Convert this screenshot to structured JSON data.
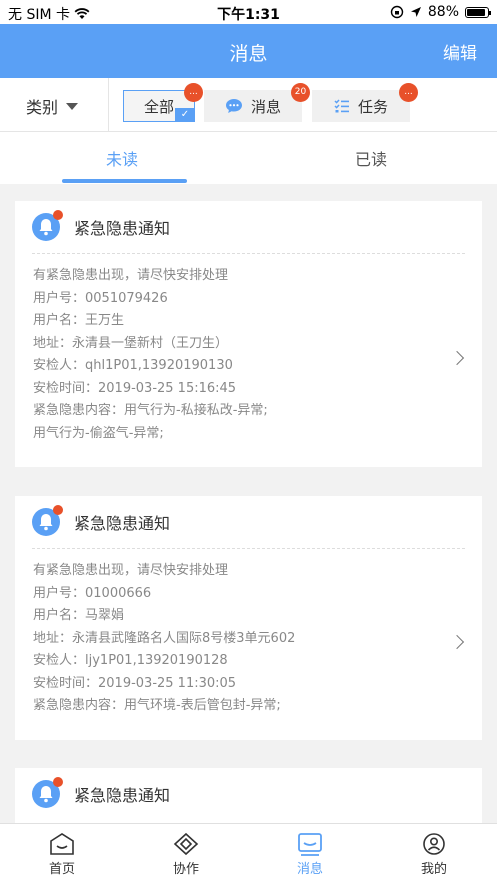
{
  "status_bar": {
    "carrier": "无 SIM 卡",
    "time": "下午1:31",
    "battery": "88%"
  },
  "nav": {
    "title": "消息",
    "edit_label": "编辑"
  },
  "filter": {
    "category_label": "类别",
    "chips": [
      {
        "label": "全部",
        "badge": "...",
        "active": true
      },
      {
        "label": "消息",
        "badge": "20",
        "icon": "chat-bubble-icon"
      },
      {
        "label": "任务",
        "badge": "...",
        "icon": "checklist-icon"
      }
    ]
  },
  "tabs": {
    "unread": "未读",
    "read": "已读"
  },
  "cards": [
    {
      "title": "紧急隐患通知",
      "lines": [
        "有紧急隐患出现，请尽快安排处理",
        "用户号：0051079426",
        "用户名：王万生",
        "地址：永清县一堡新村（王刀生）",
        "安检人：qhl1P01,13920190130",
        "安检时间：2019-03-25 15:16:45",
        "紧急隐患内容：用气行为-私接私改-异常;",
        "用气行为-偷盗气-异常;"
      ]
    },
    {
      "title": "紧急隐患通知",
      "lines": [
        "有紧急隐患出现，请尽快安排处理",
        "用户号：01000666",
        "用户名：马翠娟",
        "地址：永清县武隆路名人国际8号楼3单元602",
        "安检人：ljy1P01,13920190128",
        "安检时间：2019-03-25 11:30:05",
        "紧急隐患内容：用气环境-表后管包封-异常;"
      ]
    },
    {
      "title": "紧急隐患通知",
      "lines": []
    }
  ],
  "tab_bar": {
    "items": [
      {
        "label": "首页",
        "icon": "home-icon"
      },
      {
        "label": "协作",
        "icon": "handshake-icon"
      },
      {
        "label": "消息",
        "icon": "message-icon",
        "active": true
      },
      {
        "label": "我的",
        "icon": "profile-icon"
      }
    ],
    "active_color": "#5aa0f5"
  },
  "colors": {
    "accent": "#5aa0f5",
    "badge": "#e8512a"
  }
}
